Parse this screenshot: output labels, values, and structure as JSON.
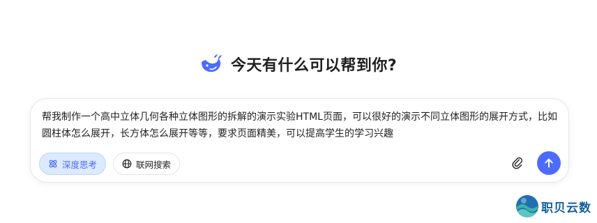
{
  "hero": {
    "title": "今天有什么可以帮到你?",
    "logo_icon": "whale-icon"
  },
  "composer": {
    "value": "帮我制作一个高中立体几何各种立体图形的拆解的演示实验HTML页面，可以很好的演示不同立体图形的展开方式，比如圆柱体怎么展开，长方体怎么展开等等，要求页面精美，可以提高学生的学习兴趣",
    "toggles": {
      "deep_think_label": "深度思考",
      "web_search_label": "联网搜索"
    },
    "attach_icon": "paperclip-icon",
    "send_icon": "arrow-up-icon"
  },
  "watermark": {
    "text": "职贝云数"
  },
  "colors": {
    "accent": "#4d6bfe",
    "chip_active_bg": "#dbeafe",
    "text": "#1f1f1f",
    "watermark": "#145f9c"
  }
}
